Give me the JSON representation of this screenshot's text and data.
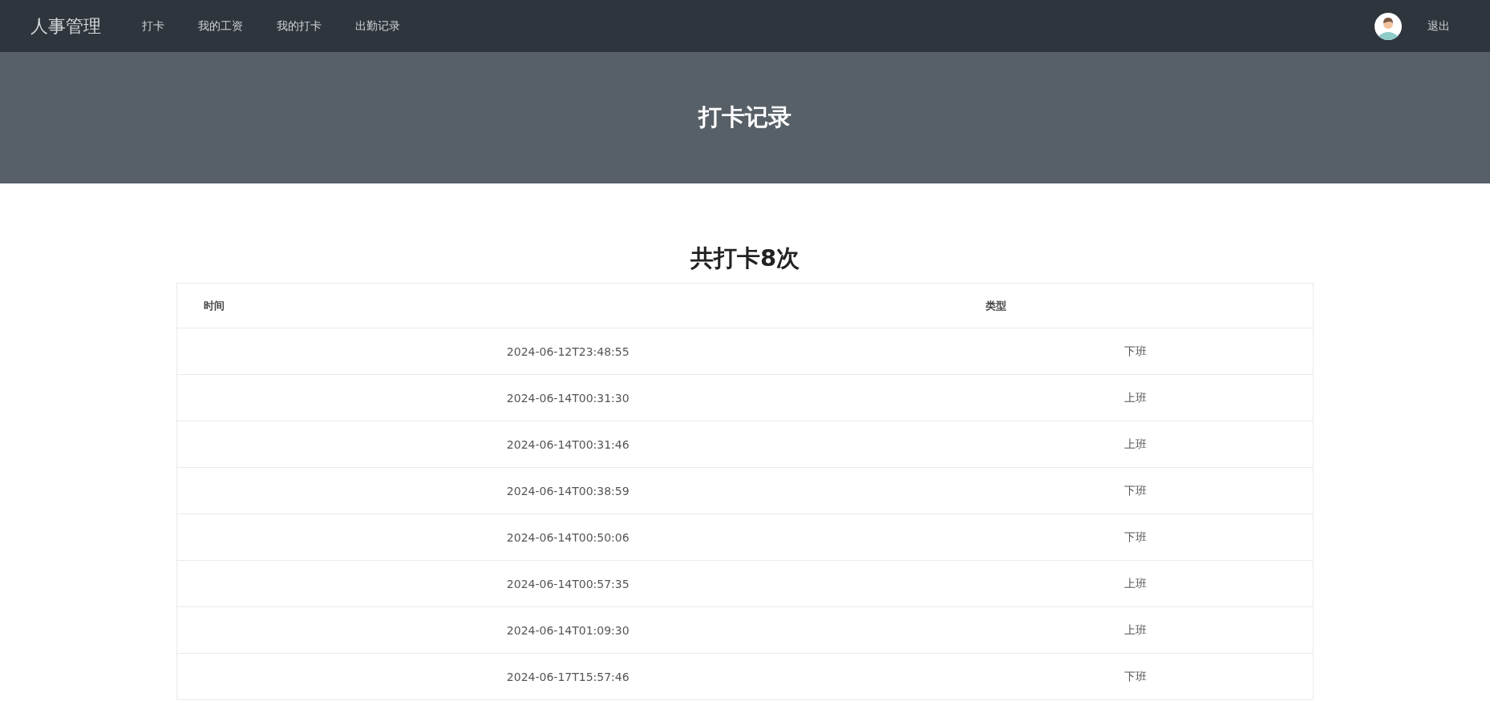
{
  "navbar": {
    "brand": "人事管理",
    "links": [
      {
        "label": "打卡"
      },
      {
        "label": "我的工资"
      },
      {
        "label": "我的打卡"
      },
      {
        "label": "出勤记录"
      }
    ],
    "logout": "退出"
  },
  "banner": {
    "title": "打卡记录"
  },
  "summary": "共打卡8次",
  "table": {
    "columns": [
      "时间",
      "类型"
    ],
    "rows": [
      {
        "time": "2024-06-12T23:48:55",
        "type": "下班"
      },
      {
        "time": "2024-06-14T00:31:30",
        "type": "上班"
      },
      {
        "time": "2024-06-14T00:31:46",
        "type": "上班"
      },
      {
        "time": "2024-06-14T00:38:59",
        "type": "下班"
      },
      {
        "time": "2024-06-14T00:50:06",
        "type": "下班"
      },
      {
        "time": "2024-06-14T00:57:35",
        "type": "上班"
      },
      {
        "time": "2024-06-14T01:09:30",
        "type": "上班"
      },
      {
        "time": "2024-06-17T15:57:46",
        "type": "下班"
      }
    ]
  }
}
